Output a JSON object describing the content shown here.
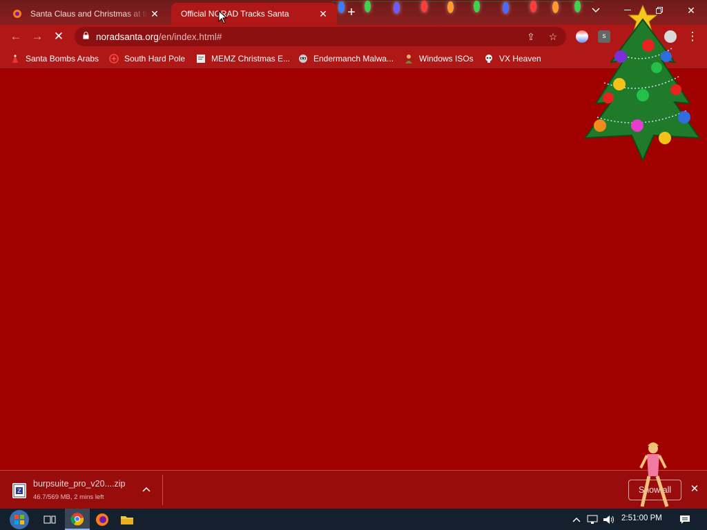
{
  "tabs": [
    {
      "title": "Santa Claus and Christmas at the",
      "active": false
    },
    {
      "title": "Official NORAD Tracks Santa",
      "active": true
    }
  ],
  "omnibox": {
    "host": "noradsanta.org",
    "path": "/en/index.html#"
  },
  "bookmarks": [
    {
      "label": "Santa Bombs Arabs",
      "icon": "santa-icon"
    },
    {
      "label": "South Hard Pole",
      "icon": "star-badge-icon"
    },
    {
      "label": "MEMZ Christmas E...",
      "icon": "page-icon"
    },
    {
      "label": "Endermanch Malwa...",
      "icon": "raccoon-icon"
    },
    {
      "label": "Windows ISOs",
      "icon": "person-icon"
    },
    {
      "label": "VX Heaven",
      "icon": "skull-icon"
    }
  ],
  "download": {
    "filename": "burpsuite_pro_v20....zip",
    "status": "46.7/569 MB, 2 mins left",
    "show_all_label": "Show all"
  },
  "taskbar": {
    "time": "2:51:00 PM"
  },
  "colors": {
    "page_bg": "#a10000",
    "chrome": "#b01818",
    "taskbar": "#14202e"
  }
}
